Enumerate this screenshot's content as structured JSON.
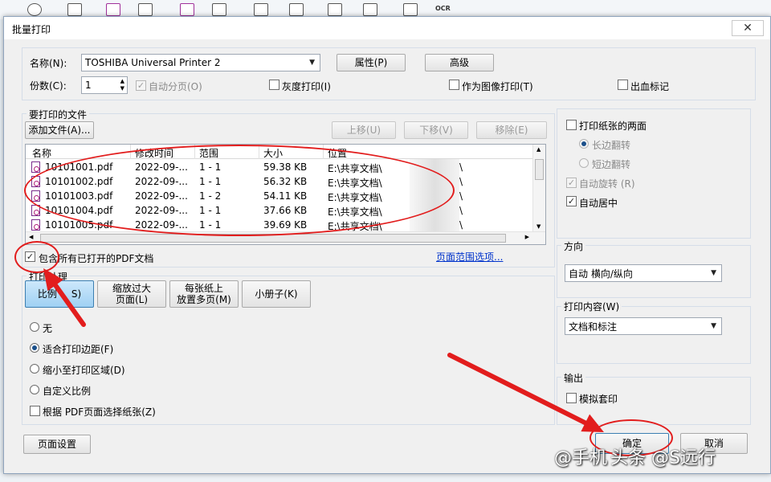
{
  "dialog": {
    "title": "批量打印",
    "close_glyph": "✕"
  },
  "printer": {
    "name_label": "名称(N):",
    "name_value": "TOSHIBA Universal Printer 2",
    "properties_button": "属性(P)",
    "advanced_button": "高级",
    "copies_label": "份数(C):",
    "copies_value": "1",
    "collate_label": "自动分页(O)",
    "grayscale_label": "灰度打印(I)",
    "print_as_image_label": "作为图像打印(T)",
    "bleed_marks_label": "出血标记"
  },
  "files": {
    "group_label": "要打印的文件",
    "add_button": "添加文件(A)...",
    "move_up_button": "上移(U)",
    "move_down_button": "下移(V)",
    "remove_button": "移除(E)",
    "columns": [
      "名称",
      "修改时间",
      "范围",
      "大小",
      "位置"
    ],
    "rows": [
      {
        "name": "10101001.pdf",
        "modified": "2022-09-...",
        "range": "1 - 1",
        "size": "59.38 KB",
        "location": "E:\\共享文档\\",
        "tail": "\\"
      },
      {
        "name": "10101002.pdf",
        "modified": "2022-09-...",
        "range": "1 - 1",
        "size": "56.32 KB",
        "location": "E:\\共享文档\\",
        "tail": "\\"
      },
      {
        "name": "10101003.pdf",
        "modified": "2022-09-...",
        "range": "1 - 2",
        "size": "54.11 KB",
        "location": "E:\\共享文档\\",
        "tail": "\\"
      },
      {
        "name": "10101004.pdf",
        "modified": "2022-09-...",
        "range": "1 - 1",
        "size": "37.66 KB",
        "location": "E:\\共享文档\\",
        "tail": "\\"
      },
      {
        "name": "10101005.pdf",
        "modified": "2022-09-...",
        "range": "1 - 1",
        "size": "39.69 KB",
        "location": "E:\\共享文档\\",
        "tail": "\\"
      }
    ],
    "include_open_label": "包含所有已打开的PDF文档",
    "page_range_link": "页面范围选项..."
  },
  "handling": {
    "group_label": "打印处理",
    "scale_button": "比例(S)",
    "scale_button_covered": "比例",
    "fit_button": "缩放过大\n页面(L)",
    "multiple_button": "每张纸上\n放置多页(M)",
    "booklet_button": "小册子(K)",
    "options": [
      "无",
      "适合打印边距(F)",
      "缩小至打印区域(D)",
      "自定义比例"
    ],
    "selected_option": "适合打印边距(F)",
    "choose_paper_label": "根据 PDF页面选择纸张(Z)"
  },
  "duplex": {
    "both_sides_label": "打印纸张的两面",
    "long_edge_label": "长边翻转",
    "short_edge_label": "短边翻转",
    "auto_rotate_label": "自动旋转 (R)",
    "auto_center_label": "自动居中"
  },
  "orientation": {
    "group_label": "方向",
    "value": "自动 横向/纵向"
  },
  "content": {
    "group_label": "打印内容(W)",
    "value": "文档和标注"
  },
  "output": {
    "group_label": "输出",
    "simulate_overprint_label": "模拟套印"
  },
  "footer": {
    "page_setup_button": "页面设置",
    "ok_button": "确定",
    "cancel_button": "取消"
  },
  "watermark": "头条 @S远行",
  "watermark_prefix": "@手机",
  "annotation_color": "#e21d1d"
}
